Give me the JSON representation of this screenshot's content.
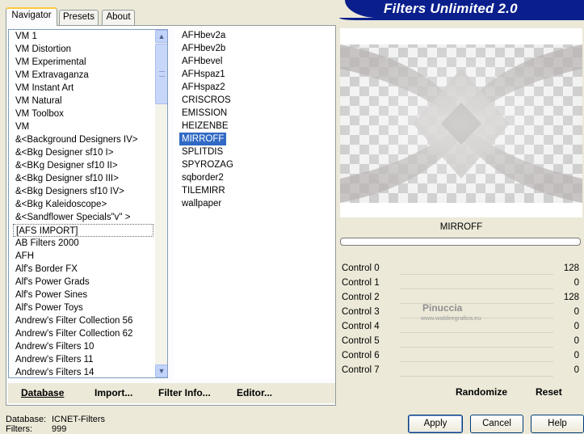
{
  "app": {
    "title": "Filters Unlimited 2.0"
  },
  "tabs": [
    {
      "label": "Navigator",
      "active": true
    },
    {
      "label": "Presets",
      "active": false
    },
    {
      "label": "About",
      "active": false
    }
  ],
  "categories": [
    "VM 1",
    "VM Distortion",
    "VM Experimental",
    "VM Extravaganza",
    "VM Instant Art",
    "VM Natural",
    "VM Toolbox",
    "VM",
    "&<Background Designers IV>",
    "&<Bkg Designer sf10 I>",
    "&<BKg Designer sf10 II>",
    "&<Bkg Designer sf10 III>",
    "&<Bkg Designers sf10 IV>",
    "&<Bkg Kaleidoscope>",
    "&<Sandflower Specials\"v\" >",
    "[AFS IMPORT]",
    "AB Filters 2000",
    "AFH",
    "Alf's Border FX",
    "Alf's Power Grads",
    "Alf's Power Sines",
    "Alf's Power Toys",
    "Andrew's Filter Collection 56",
    "Andrew's Filter Collection 62",
    "Andrew's Filters 10",
    "Andrew's Filters 11",
    "Andrew's Filters 14"
  ],
  "selected_category": "[AFS IMPORT]",
  "filters": [
    "AFHbev2a",
    "AFHbev2b",
    "AFHbevel",
    "AFHspaz1",
    "AFHspaz2",
    "CRISCROS",
    "EMISSION",
    "HEIZENBE",
    "MIRROFF",
    "SPLITDIS",
    "SPYROZAG",
    "sqborder2",
    "TILEMIRR",
    "wallpaper"
  ],
  "selected_filter": "MIRROFF",
  "panel_buttons": {
    "database": "Database",
    "import": "Import...",
    "filter_info": "Filter Info...",
    "editor": "Editor..."
  },
  "preview": {
    "filter_name": "MIRROFF",
    "progress": 0
  },
  "controls": [
    {
      "label": "Control 0",
      "value": "128"
    },
    {
      "label": "Control 1",
      "value": "0"
    },
    {
      "label": "Control 2",
      "value": "128"
    },
    {
      "label": "Control 3",
      "value": "0"
    },
    {
      "label": "Control 4",
      "value": "0"
    },
    {
      "label": "Control 5",
      "value": "0"
    },
    {
      "label": "Control 6",
      "value": "0"
    },
    {
      "label": "Control 7",
      "value": "0"
    }
  ],
  "watermark": {
    "name": "Pinuccia",
    "url": "www.waldiregrafica.eu"
  },
  "right_buttons": {
    "randomize": "Randomize",
    "reset": "Reset"
  },
  "status": {
    "database_label": "Database:",
    "database_value": "ICNET-Filters",
    "filters_label": "Filters:",
    "filters_value": "999"
  },
  "dialog_buttons": {
    "apply": "Apply",
    "cancel": "Cancel",
    "help": "Help"
  },
  "colors": {
    "banner": "#0a1f8c",
    "selection": "#316ac5",
    "background": "#ece9d8"
  }
}
